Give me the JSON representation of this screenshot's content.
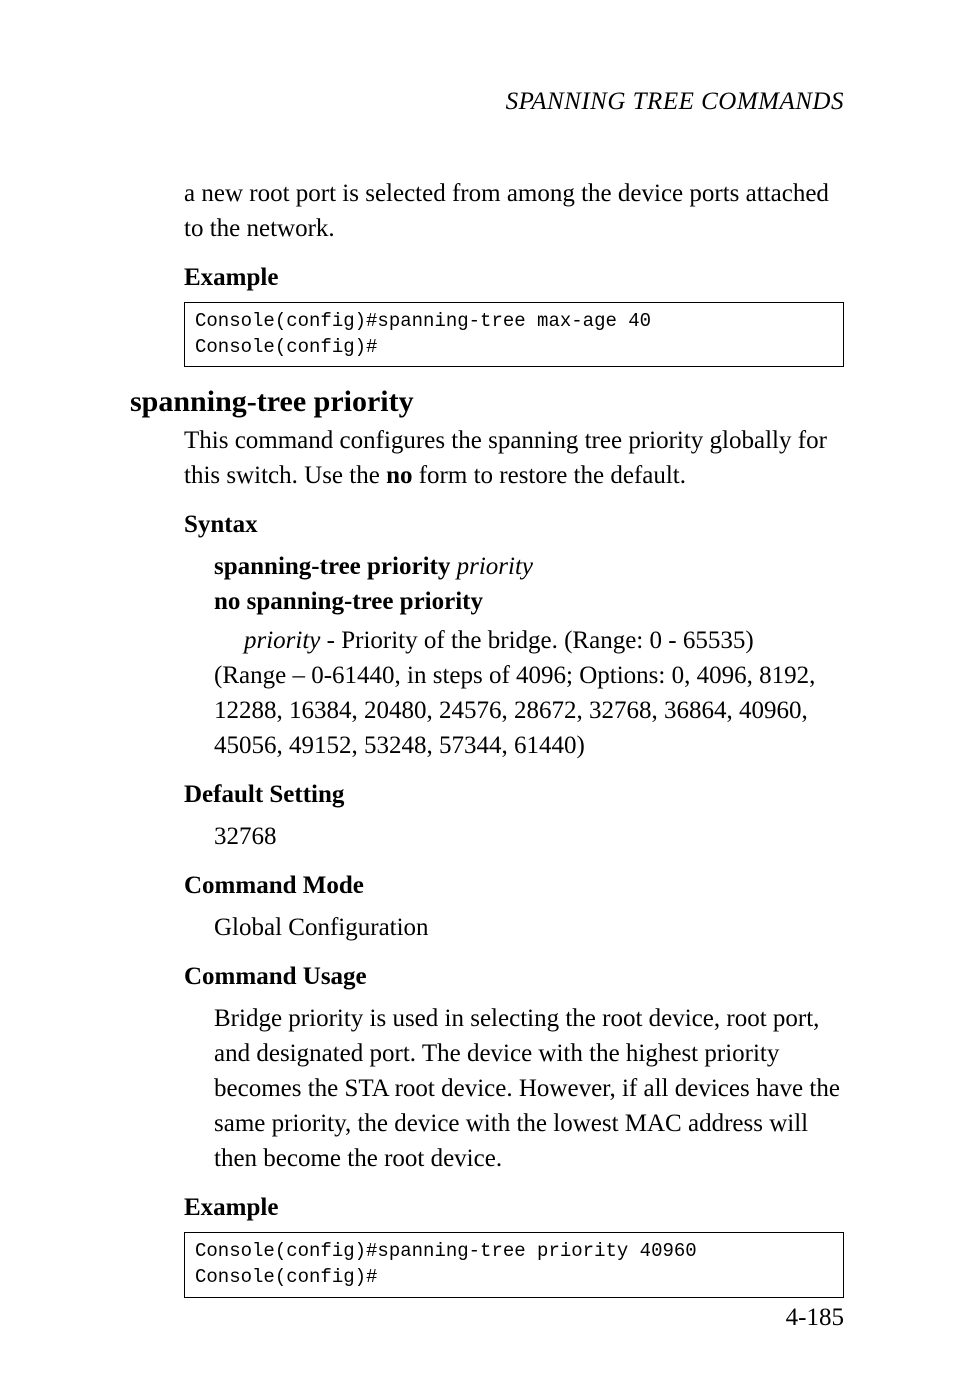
{
  "running_head": "SPANNING TREE COMMANDS",
  "intro_paragraph": "a new root port is selected from among the device ports attached to the network.",
  "example1": {
    "label": "Example",
    "code": "Console(config)#spanning-tree max-age 40\nConsole(config)#"
  },
  "command": {
    "title": "spanning-tree priority",
    "description_part1": "This command configures the spanning tree priority globally for this switch. Use the ",
    "description_bold": "no",
    "description_part2": " form to restore the default."
  },
  "syntax": {
    "label": "Syntax",
    "line1_bold": "spanning-tree priority ",
    "line1_ital": "priority",
    "line2": "no spanning-tree priority",
    "param_ital": "priority",
    "param_rest": " - Priority of the bridge. (Range: 0 - 65535)",
    "range_lines": "(Range – 0-61440, in steps of 4096; Options: 0, 4096, 8192, 12288, 16384, 20480, 24576, 28672, 32768, 36864, 40960, 45056, 49152, 53248, 57344, 61440)"
  },
  "default_setting": {
    "label": "Default Setting",
    "value": "32768"
  },
  "command_mode": {
    "label": "Command Mode",
    "value": "Global Configuration"
  },
  "command_usage": {
    "label": "Command Usage",
    "text": "Bridge priority is used in selecting the root device, root port, and designated port. The device with the highest priority becomes the STA root device. However, if all devices have the same priority, the device with the lowest MAC address will then become the root device."
  },
  "example2": {
    "label": "Example",
    "code": "Console(config)#spanning-tree priority 40960\nConsole(config)#"
  },
  "page_number": "4-185"
}
